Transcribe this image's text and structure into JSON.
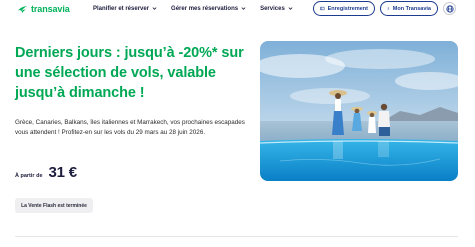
{
  "brand": {
    "name": "transavia",
    "accent": "#00b25a",
    "navy": "#1d3b8f"
  },
  "nav": {
    "menu": [
      {
        "label": "Planifier et réserver"
      },
      {
        "label": "Gérer mes réservations"
      },
      {
        "label": "Services"
      }
    ],
    "register_label": "Enregistrement",
    "account_label": "Mon Transavia",
    "language_icon": "globe-icon"
  },
  "promo": {
    "headline": "Derniers jours : jusqu’à -20%* sur une sélection de vols, valable jusqu’à dimanche !",
    "description": "Grèce, Canaries, Balkans, îles italiennes et Marrakech, vos prochaines escapades vous attendent ! Profitez-en sur les vols du 29 mars au 28 juin 2026.",
    "price_prefix": "À partir de",
    "price_value": "31 €",
    "status_badge": "La Vente Flash est terminée"
  }
}
